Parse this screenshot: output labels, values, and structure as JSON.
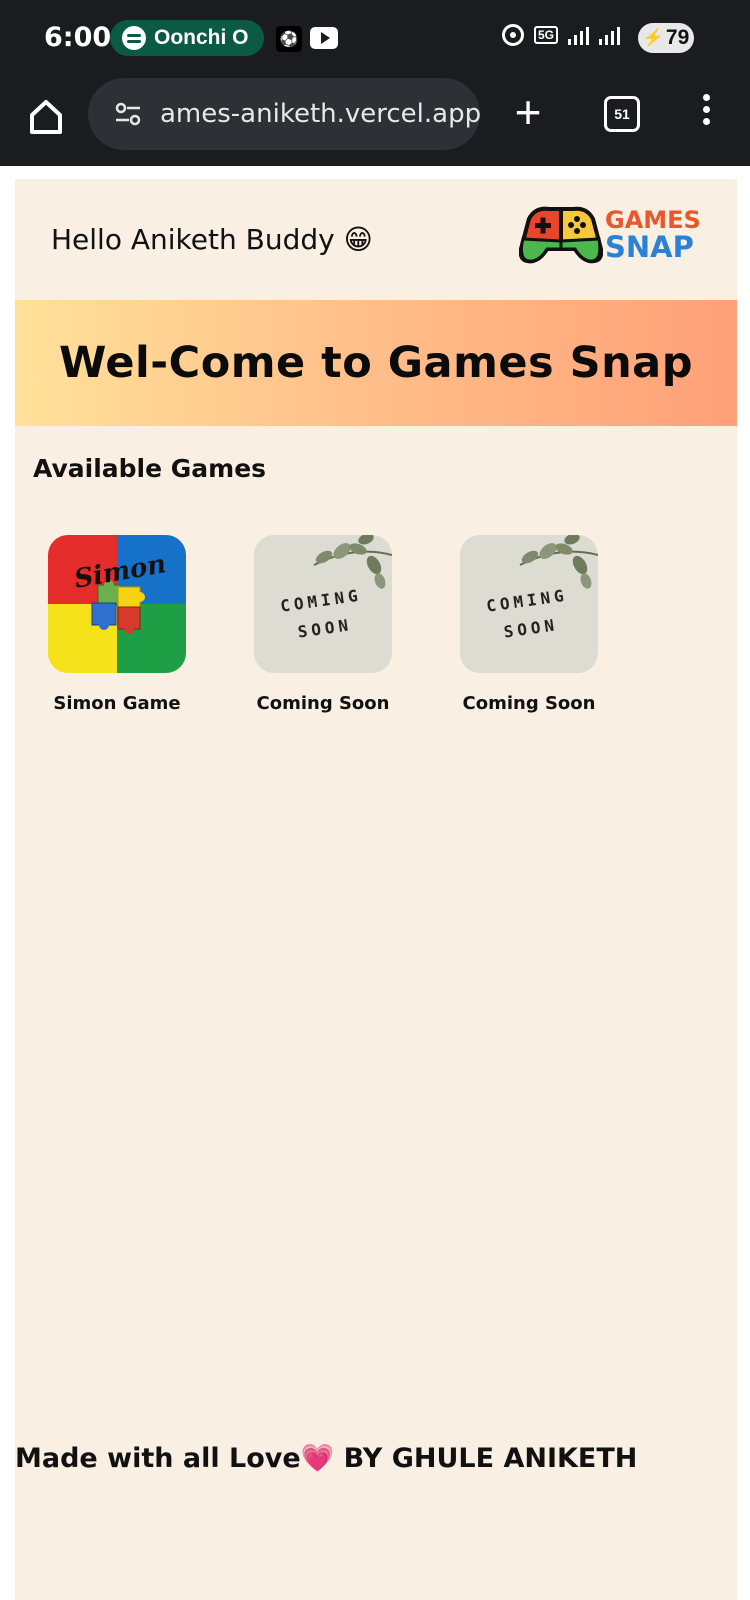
{
  "status_bar": {
    "time": "6:00",
    "media_pill": "Oonchi O",
    "battery": "79",
    "network": "5G"
  },
  "browser": {
    "url": "ames-aniketh.vercel.app",
    "tab_count": "51"
  },
  "page": {
    "greeting": "Hello Aniketh Buddy 😁",
    "logo": {
      "line1": "GAMES",
      "line2": "SNAP"
    },
    "banner_title": "Wel-Come to Games Snap",
    "section_title": "Available Games",
    "games": [
      {
        "label": "Simon Game",
        "thumb_text": "Simon"
      },
      {
        "label": "Coming Soon",
        "thumb_line1": "COMING",
        "thumb_line2": "SOON"
      },
      {
        "label": "Coming Soon",
        "thumb_line1": "COMING",
        "thumb_line2": "SOON"
      }
    ],
    "footer": "Made with all Love💗 BY GHULE ANIKETH"
  },
  "colors": {
    "page_bg": "#f9efe3",
    "banner_start": "#ffe19a",
    "banner_end": "#ffa078",
    "status_bg": "#1b1c20",
    "pill_bg": "#0b5a46"
  }
}
